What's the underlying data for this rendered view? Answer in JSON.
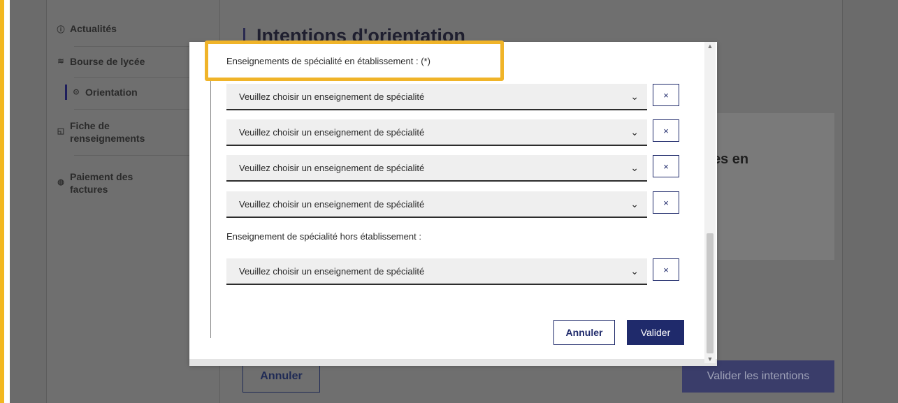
{
  "sidebar": {
    "items": [
      {
        "icon": "info-circle-icon",
        "glyph": "ⓘ",
        "label": "Actualités"
      },
      {
        "icon": "bourse-icon",
        "glyph": "≋",
        "label": "Bourse de lycée"
      },
      {
        "icon": "compass-icon",
        "glyph": "⊙",
        "label": "Orientation"
      },
      {
        "icon": "form-icon",
        "glyph": "◱",
        "label": "Fiche de renseignements"
      },
      {
        "icon": "payment-icon",
        "glyph": "◍",
        "label": "Paiement des factures"
      }
    ],
    "active_index": 2
  },
  "background": {
    "title": "Intentions d'orientation",
    "card_text": "es en",
    "cancel_label": "Annuler",
    "submit_label": "Valider les intentions"
  },
  "modal": {
    "section1_label": "Enseignements de spécialité en établissement : (*)",
    "section2_label": "Enseignement de spécialité hors établissement :",
    "select_placeholder": "Veuillez choisir un enseignement de spécialité",
    "clear_glyph": "×",
    "chevron_glyph": "⌄",
    "cancel_label": "Annuler",
    "validate_label": "Valider"
  },
  "colors": {
    "accent": "#f0b429",
    "primary": "#1f2a6b",
    "overlay": "#6f6f6f"
  }
}
